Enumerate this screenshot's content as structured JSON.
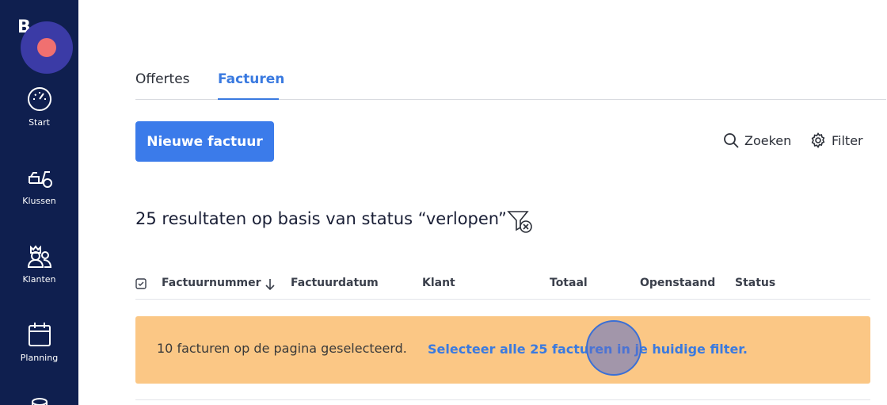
{
  "sidebar": {
    "logo_letter": "B",
    "items": [
      {
        "label": "Start",
        "icon": "dashboard-gauge-icon"
      },
      {
        "label": "Klussen",
        "icon": "scooter-icon"
      },
      {
        "label": "Klanten",
        "icon": "customers-icon"
      },
      {
        "label": "Planning",
        "icon": "calendar-icon"
      }
    ]
  },
  "tabs": [
    {
      "label": "Offertes",
      "active": false
    },
    {
      "label": "Facturen",
      "active": true
    }
  ],
  "toolbar": {
    "new_invoice_label": "Nieuwe factuur",
    "search_label": "Zoeken",
    "filter_label": "Filter"
  },
  "results": {
    "summary": "25 resultaten op basis van status “verlopen”"
  },
  "table": {
    "columns": [
      "Factuurnummer",
      "Factuurdatum",
      "Klant",
      "Totaal",
      "Openstaand",
      "Status"
    ]
  },
  "banner": {
    "selected_text": "10 facturen op de pagina geselecteerd.",
    "select_all_link": "Selecteer alle 25 facturen in je huidige filter."
  },
  "colors": {
    "sidebar_bg": "#0f1f4f",
    "accent": "#3b7bea",
    "banner_bg": "#fbc785",
    "record_indicator": "#f07070"
  }
}
